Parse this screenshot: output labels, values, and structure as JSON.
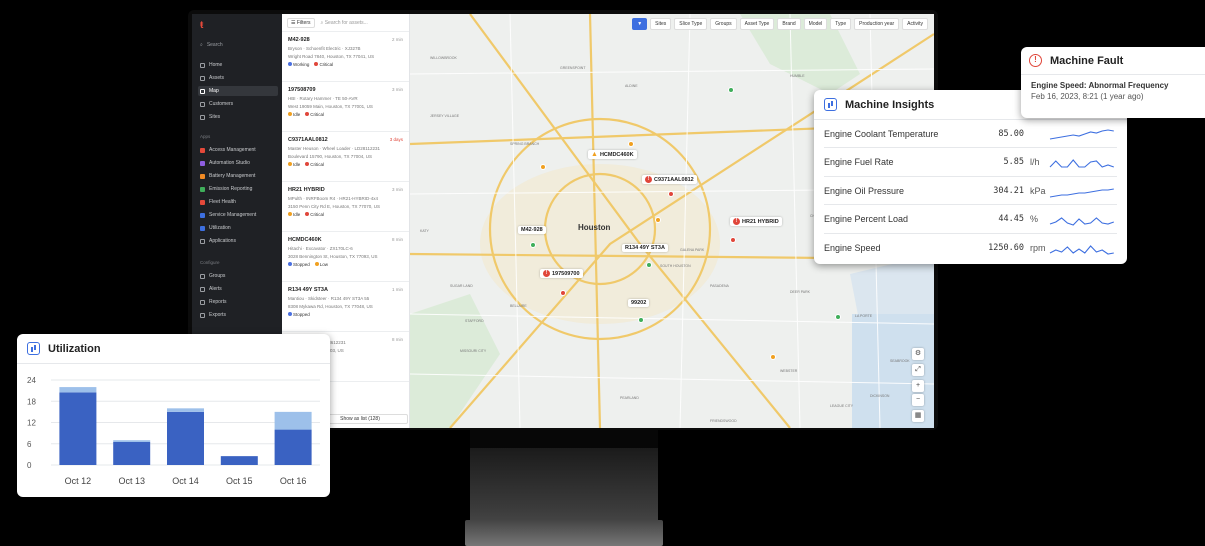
{
  "nav": {
    "search": "Search",
    "items": [
      "Home",
      "Assets",
      "Map",
      "Customers",
      "Sites"
    ],
    "apps_section": "Apps",
    "apps": [
      "Access Management",
      "Automation Studio",
      "Battery Management",
      "Emission Reporting",
      "Fleet Health",
      "Service Management",
      "Utilization",
      "Applications"
    ],
    "config_section": "Configure",
    "config": [
      "Groups",
      "Alerts",
      "Reports",
      "Exports"
    ]
  },
  "list": {
    "filters": "Filters",
    "search_placeholder": "Search for assets...",
    "footer": "Show as list (128)",
    "assets": [
      {
        "id": "M42-928",
        "ago": "2 min",
        "line1": "Bryson · Schoenfit Electric · XJ327B",
        "line2": "Wright Road 7840, Houston, TX 77041, US",
        "s1": "Working",
        "s2": "Critical",
        "c1": "#4a6fe0",
        "c2": "#e0463a"
      },
      {
        "id": "197508709",
        "ago": "3 min",
        "line1": "HBI · Rotary Hammer · TE 50-AVR",
        "line2": "West 19059 Main, Houston, TX 77001, US",
        "s1": "Idle",
        "s2": "Critical",
        "c1": "#f0a020",
        "c2": "#e0463a"
      },
      {
        "id": "C9371AAL0812",
        "ago": "3 days",
        "line1": "Master Heuson · Wheel Loader · LD28112231",
        "line2": "Boulevard 15790, Houston, TX 77004, US",
        "s1": "Idle",
        "s2": "Critical",
        "c1": "#f0a020",
        "c2": "#e0463a",
        "alert": true
      },
      {
        "id": "HR21 HYBRID",
        "ago": "3 min",
        "line1": "MPulth · INRFBoom R4 · HR21-HYBRID-4x4",
        "line2": "3150 Penn City Rd E, Houston, TX 77070, US",
        "s1": "Idle",
        "s2": "Critical",
        "c1": "#f0a020",
        "c2": "#e0463a"
      },
      {
        "id": "HCMDC460K",
        "ago": "8 min",
        "line1": "Hitachi · Excavator · ZX170LC-6",
        "line2": "3028 Bennington St, Houston, TX 77093, US",
        "s1": "Stopped",
        "s2": "Low",
        "c1": "#4a6fe0",
        "c2": "#f0a020"
      },
      {
        "id": "R134 49Y ST3A",
        "ago": "1 min",
        "line1": "Mantiou · Skidsteer · R134 49Y ST3A 55",
        "line2": "8308 Mykawa Rd, Houston, TX 77048, US",
        "s1": "Stopped",
        "s2": "",
        "c1": "#4a6fe0",
        "c2": ""
      },
      {
        "id": "",
        "ago": "8 min",
        "line1": "Wheel Loader · LD28612231",
        "line2": "Rd, Houston, TX 77003, US",
        "s1": "",
        "s2": "",
        "c1": "",
        "c2": ""
      }
    ]
  },
  "map": {
    "filters": [
      "Sites",
      "Slice Type",
      "Groups",
      "Asset Type",
      "Brand",
      "Model",
      "Type",
      "Production year",
      "Activity"
    ],
    "city": "Houston",
    "pins": [
      {
        "label": "HCMDC460K",
        "kind": "warn"
      },
      {
        "label": "C9371AAL0812",
        "kind": "red"
      },
      {
        "label": "HR21 HYBRID",
        "kind": "red"
      },
      {
        "label": "M42-928",
        "kind": "plain"
      },
      {
        "label": "R134 49Y ST3A",
        "kind": "plain"
      },
      {
        "label": "197509700",
        "kind": "red"
      },
      {
        "label": "99202",
        "kind": "plain"
      }
    ],
    "places": [
      "WILLOWBROOK",
      "GREENSPOINT",
      "ALDINE",
      "SPRING BRANCH",
      "GALENA PARK",
      "PASADENA",
      "DEER PARK",
      "BELLAIRE",
      "MISSOURI CITY",
      "PEARLAND",
      "FRIENDSWOOD",
      "CHANNELVIEW",
      "BAYTOWN",
      "LA PORTE",
      "SEABROOK",
      "HUMBLE",
      "CROSBY",
      "KATY",
      "SUGAR LAND",
      "STAFFORD",
      "JERSEY VILLAGE",
      "SOUTH HOUSTON",
      "WEBSTER",
      "LEAGUE CITY",
      "DICKINSON"
    ]
  },
  "utilization": {
    "title": "Utilization",
    "chart_data": {
      "type": "bar",
      "categories": [
        "Oct 12",
        "Oct 13",
        "Oct 14",
        "Oct 15",
        "Oct 16"
      ],
      "series": [
        {
          "values": [
            20.5,
            6.5,
            15,
            2.5,
            10
          ]
        },
        {
          "values": [
            1.5,
            0.5,
            1,
            0,
            5
          ]
        }
      ],
      "yticks": [
        0,
        6,
        12,
        18,
        24
      ],
      "ylim": [
        0,
        24
      ],
      "colors": [
        "#3a62c2",
        "#9dc0ea"
      ]
    }
  },
  "insights": {
    "title": "Machine Insights",
    "rows": [
      {
        "label": "Engine Coolant Temperature",
        "value": "85.00",
        "unit": ""
      },
      {
        "label": "Engine Fuel Rate",
        "value": "5.85",
        "unit": "l/h"
      },
      {
        "label": "Engine Oil Pressure",
        "value": "304.21",
        "unit": "kPa"
      },
      {
        "label": "Engine Percent Load",
        "value": "44.45",
        "unit": "%"
      },
      {
        "label": "Engine Speed",
        "value": "1250.60",
        "unit": "rpm"
      }
    ],
    "spark_color": "#3d6fe0"
  },
  "fault": {
    "title": "Machine Fault",
    "message": "Engine Speed: Abnormal Frequency",
    "date": "Feb 16, 2023, 8:21 (1 year ago)"
  }
}
